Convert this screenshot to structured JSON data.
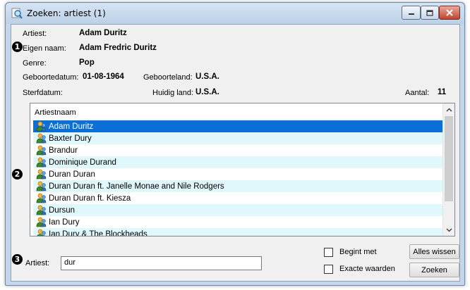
{
  "window": {
    "title": "Zoeken: artiest (1)"
  },
  "details": {
    "artiest_label": "Artiest:",
    "artiest_value": "Adam Duritz",
    "eigen_naam_label": "Eigen naam:",
    "eigen_naam_value": "Adam Fredric Duritz",
    "genre_label": "Genre:",
    "genre_value": "Pop",
    "geboortedatum_label": "Geboortedatum:",
    "geboortedatum_value": "01-08-1964",
    "geboorteland_label": "Geboorteland:",
    "geboorteland_value": "U.S.A.",
    "sterfdatum_label": "Sterfdatum:",
    "huidig_land_label": "Huidig land:",
    "huidig_land_value": "U.S.A.",
    "aantal_label": "Aantal:",
    "aantal_value": "11"
  },
  "list": {
    "header": "Artiestnaam",
    "rows": [
      "Adam Duritz",
      "Baxter Dury",
      "Brandur",
      "Dominique Durand",
      "Duran Duran",
      "Duran Duran ft. Janelle Monae and Nile Rodgers",
      "Duran Duran ft. Kiesza",
      "Dursun",
      "Ian Dury",
      "Ian Dury & The Blockheads"
    ],
    "selected_index": 0
  },
  "markers": [
    "1",
    "2",
    "3"
  ],
  "search": {
    "label": "Artiest:",
    "value": "dur",
    "begint_met_label": "Begint met",
    "exacte_waarden_label": "Exacte waarden",
    "alles_wissen_label": "Alles wissen",
    "zoeken_label": "Zoeken"
  },
  "colors": {
    "selection": "#0a6fd7",
    "alt_row": "#e0f7fb"
  }
}
